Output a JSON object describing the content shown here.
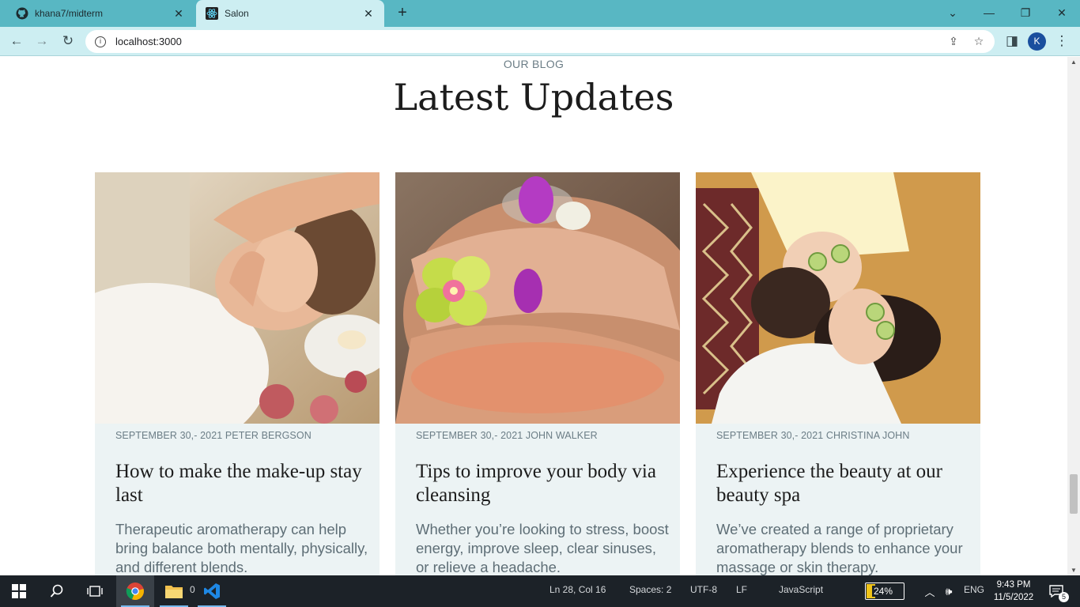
{
  "browser": {
    "tabs": [
      {
        "title": "khana7/midterm",
        "favicon": "github-icon"
      },
      {
        "title": "Salon",
        "favicon": "react-icon"
      }
    ],
    "new_tab_glyph": "+",
    "url": "localhost:3000",
    "profile_initial": "K"
  },
  "page": {
    "eyebrow": "OUR BLOG",
    "headline": "Latest Updates",
    "posts": [
      {
        "meta": "SEPTEMBER 30,- 2021 PETER BERGSON",
        "title": "How to make the make-up stay last",
        "excerpt": "Therapeutic aromatherapy can help bring balance both mentally, physically, and different blends.",
        "image": "facial-massage-photo"
      },
      {
        "meta": "SEPTEMBER 30,- 2021 JOHN WALKER",
        "title": "Tips to improve your body via cleansing",
        "excerpt": "Whether you’re looking to stress, boost energy, improve sleep, clear sinuses, or relieve a headache.",
        "image": "foot-spa-photo"
      },
      {
        "meta": "SEPTEMBER 30,- 2021 CHRISTINA JOHN",
        "title": "Experience the beauty at our beauty spa",
        "excerpt": "We’ve created a range of proprietary aromatherapy blends to enhance your massage or skin therapy.",
        "image": "cucumber-mask-photo"
      }
    ]
  },
  "taskbar": {
    "status_items": [
      "Ln 28, Col 16",
      "Spaces: 2",
      "UTF-8",
      "LF",
      "JavaScript"
    ],
    "battery": "24%",
    "battery_level": 0.24,
    "language": "ENG",
    "time": "9:43 PM",
    "date": "11/5/2022",
    "notification_count": "5",
    "sync_count": "0"
  },
  "colors": {
    "chrome_accent": "#58b7c3",
    "toolbar_bg": "#cdeef2",
    "card_bg": "#ecf3f4",
    "meta_text": "#6b7d86"
  }
}
